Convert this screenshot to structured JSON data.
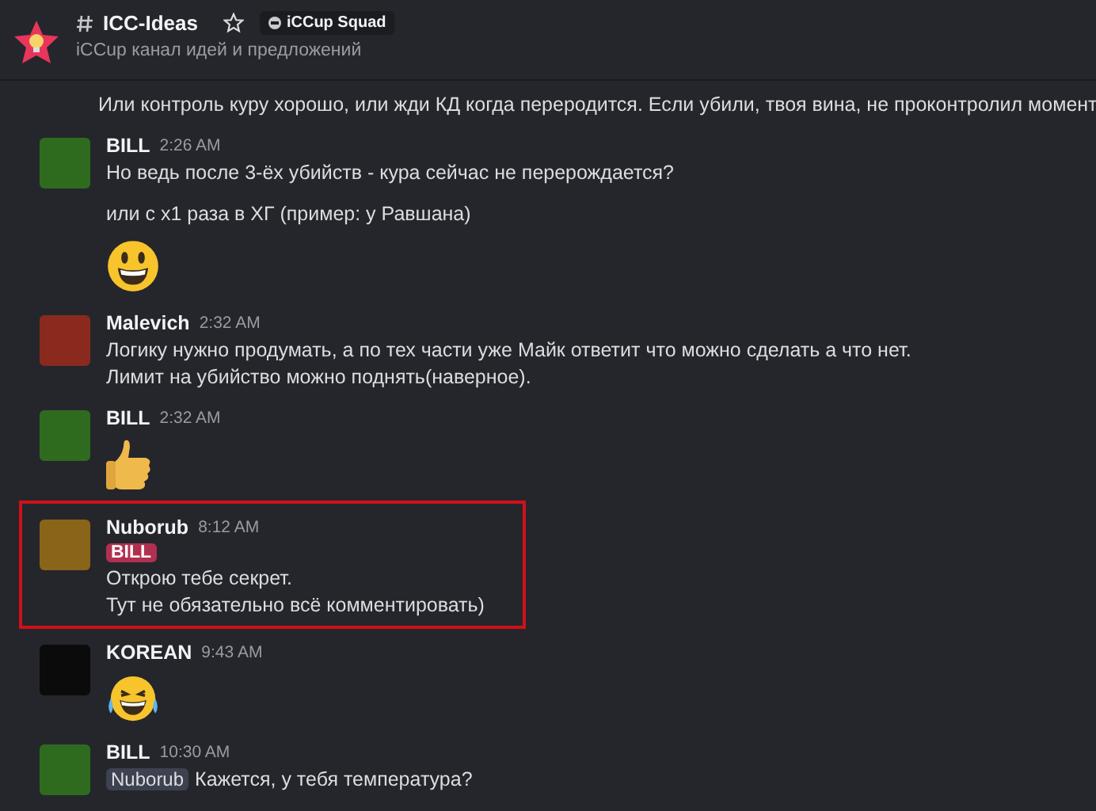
{
  "header": {
    "channel": "ICC-Ideas",
    "badge": "iCCup Squad",
    "topic": "iCCup канал идей и предложений"
  },
  "messages": [
    {
      "continuation": true,
      "highlighted": false,
      "blocks": [
        {
          "kind": "text",
          "text": "Или контроль куру хорошо, или жди КД когда переродится. Если убили, твоя вина, не проконтролил момент"
        }
      ]
    },
    {
      "continuation": false,
      "highlighted": false,
      "author": "BILL",
      "time": "2:26 AM",
      "color": "#2f6b1f",
      "blocks": [
        {
          "kind": "text",
          "text": "Но ведь после 3-ёх убийств - кура сейчас не перерождается?"
        },
        {
          "kind": "spacer"
        },
        {
          "kind": "text",
          "text": "или с х1 раза в ХГ (пример: у Равшана)"
        },
        {
          "kind": "grin"
        }
      ]
    },
    {
      "continuation": false,
      "highlighted": false,
      "author": "Malevich",
      "time": "2:32 AM",
      "color": "#8a2a1e",
      "blocks": [
        {
          "kind": "text",
          "text": "Логику нужно продумать, а по тех части уже Майк ответит что можно сделать а что нет."
        },
        {
          "kind": "text",
          "text": "Лимит на убийство можно поднять(наверное)."
        }
      ]
    },
    {
      "continuation": false,
      "highlighted": false,
      "author": "BILL",
      "time": "2:32 AM",
      "color": "#2f6b1f",
      "blocks": [
        {
          "kind": "thumbs"
        }
      ]
    },
    {
      "continuation": false,
      "highlighted": true,
      "author": "Nuborub",
      "time": "8:12 AM",
      "color": "#8a6418",
      "blocks": [
        {
          "kind": "role_mention",
          "text": "BILL"
        },
        {
          "kind": "text",
          "text": "Открою тебе секрет."
        },
        {
          "kind": "text",
          "text": "Тут не обязательно всё комментировать)"
        }
      ]
    },
    {
      "continuation": false,
      "highlighted": false,
      "author": "KOREAN",
      "time": "9:43 AM",
      "color": "#0b0b0b",
      "blocks": [
        {
          "kind": "laugh"
        }
      ]
    },
    {
      "continuation": false,
      "highlighted": false,
      "author": "BILL",
      "time": "10:30 AM",
      "color": "#2f6b1f",
      "blocks": [
        {
          "kind": "mention_line",
          "mention": "Nuborub",
          "text": "Кажется, у тебя температура?"
        }
      ]
    }
  ]
}
